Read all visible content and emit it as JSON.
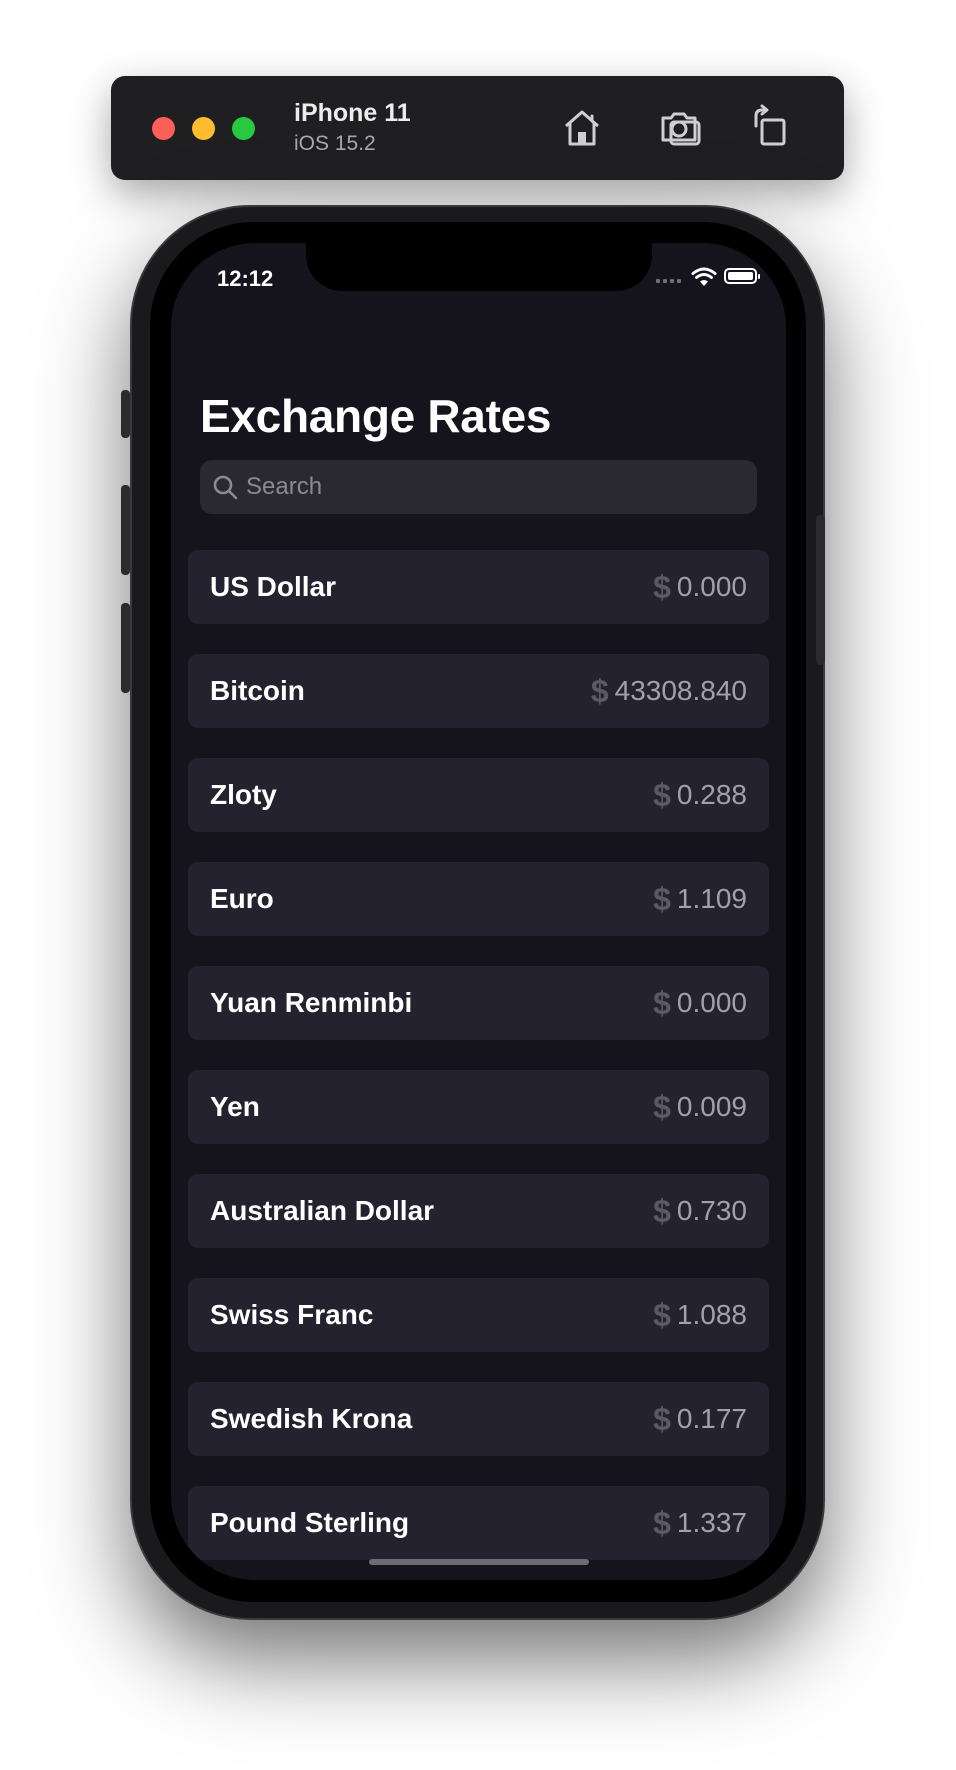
{
  "simulator": {
    "device_name": "iPhone 11",
    "os_version": "iOS 15.2",
    "buttons": [
      "home-icon",
      "screenshot-icon",
      "rotate-icon"
    ]
  },
  "status_bar": {
    "time": "12:12",
    "icons": [
      "cellular-signal-icon",
      "wifi-icon",
      "battery-icon"
    ]
  },
  "app": {
    "title": "Exchange Rates",
    "search": {
      "placeholder": "Search",
      "value": "",
      "icon": "magnifying-glass-icon"
    },
    "rates": [
      {
        "name": "US Dollar",
        "symbol": "$",
        "value": "0.000"
      },
      {
        "name": "Bitcoin",
        "symbol": "$",
        "value": "43308.840"
      },
      {
        "name": "Zloty",
        "symbol": "$",
        "value": "0.288"
      },
      {
        "name": "Euro",
        "symbol": "$",
        "value": "1.109"
      },
      {
        "name": "Yuan Renminbi",
        "symbol": "$",
        "value": "0.000"
      },
      {
        "name": "Yen",
        "symbol": "$",
        "value": "0.009"
      },
      {
        "name": "Australian Dollar",
        "symbol": "$",
        "value": "0.730"
      },
      {
        "name": "Swiss Franc",
        "symbol": "$",
        "value": "1.088"
      },
      {
        "name": "Swedish Krona",
        "symbol": "$",
        "value": "0.177"
      },
      {
        "name": "Pound Sterling",
        "symbol": "$",
        "value": "1.337"
      }
    ]
  },
  "colors": {
    "screen_background": "#15141d",
    "row_background": "#24222f",
    "search_background": "#2a2931",
    "text_primary": "#ffffff",
    "text_secondary": "#a2a1a9",
    "symbol": "#5b5a63"
  }
}
